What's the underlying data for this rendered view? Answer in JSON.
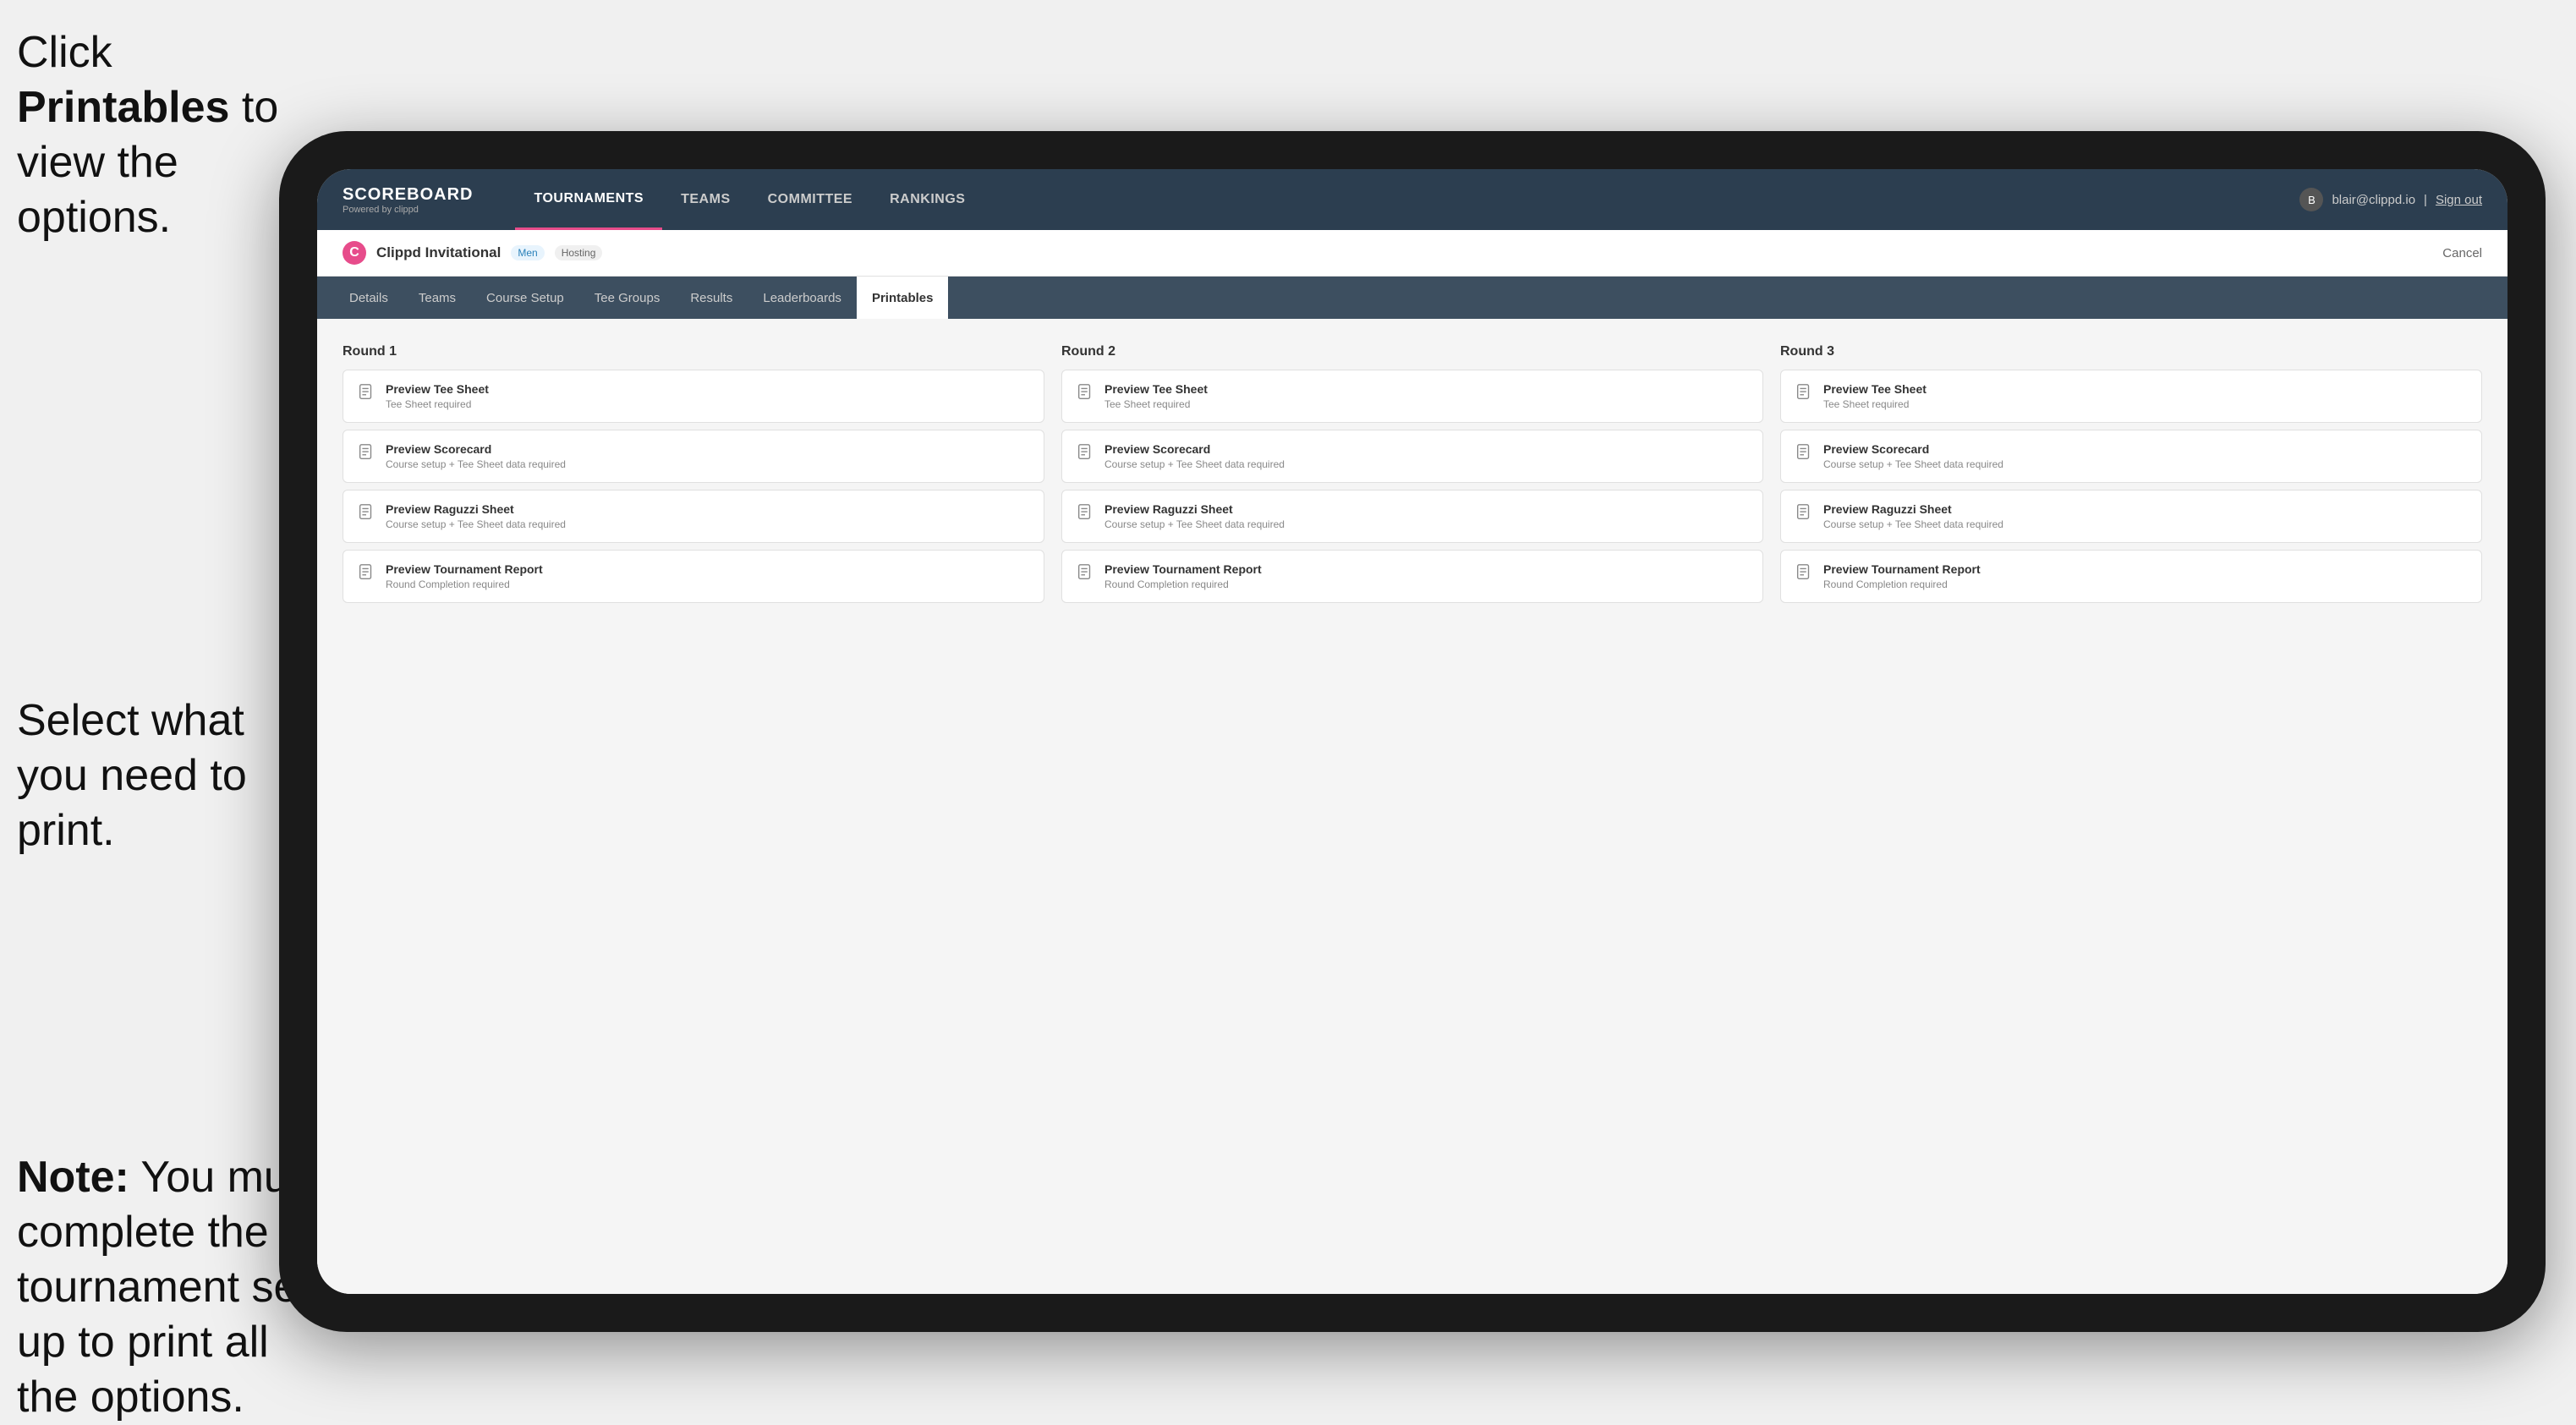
{
  "instructions": {
    "top": {
      "prefix": "Click ",
      "bold": "Printables",
      "suffix": " to view the options."
    },
    "middle": {
      "text": "Select what you need to print."
    },
    "bottom": {
      "bold_prefix": "Note:",
      "text": " You must complete the tournament set-up to print all the options."
    }
  },
  "topNav": {
    "logo": {
      "title": "SCOREBOARD",
      "powered": "Powered by clippd"
    },
    "links": [
      {
        "label": "TOURNAMENTS",
        "active": true
      },
      {
        "label": "TEAMS",
        "active": false
      },
      {
        "label": "COMMITTEE",
        "active": false
      },
      {
        "label": "RANKINGS",
        "active": false
      }
    ],
    "user": {
      "email": "blair@clippd.io",
      "signout": "Sign out"
    }
  },
  "subHeader": {
    "logo": "C",
    "name": "Clippd Invitational",
    "badge": "Men",
    "hosting": "Hosting",
    "cancel": "Cancel"
  },
  "tabs": [
    {
      "label": "Details",
      "active": false
    },
    {
      "label": "Teams",
      "active": false
    },
    {
      "label": "Course Setup",
      "active": false
    },
    {
      "label": "Tee Groups",
      "active": false
    },
    {
      "label": "Results",
      "active": false
    },
    {
      "label": "Leaderboards",
      "active": false
    },
    {
      "label": "Printables",
      "active": true
    }
  ],
  "rounds": [
    {
      "title": "Round 1",
      "cards": [
        {
          "title": "Preview Tee Sheet",
          "subtitle": "Tee Sheet required"
        },
        {
          "title": "Preview Scorecard",
          "subtitle": "Course setup + Tee Sheet data required"
        },
        {
          "title": "Preview Raguzzi Sheet",
          "subtitle": "Course setup + Tee Sheet data required"
        },
        {
          "title": "Preview Tournament Report",
          "subtitle": "Round Completion required"
        }
      ]
    },
    {
      "title": "Round 2",
      "cards": [
        {
          "title": "Preview Tee Sheet",
          "subtitle": "Tee Sheet required"
        },
        {
          "title": "Preview Scorecard",
          "subtitle": "Course setup + Tee Sheet data required"
        },
        {
          "title": "Preview Raguzzi Sheet",
          "subtitle": "Course setup + Tee Sheet data required"
        },
        {
          "title": "Preview Tournament Report",
          "subtitle": "Round Completion required"
        }
      ]
    },
    {
      "title": "Round 3",
      "cards": [
        {
          "title": "Preview Tee Sheet",
          "subtitle": "Tee Sheet required"
        },
        {
          "title": "Preview Scorecard",
          "subtitle": "Course setup + Tee Sheet data required"
        },
        {
          "title": "Preview Raguzzi Sheet",
          "subtitle": "Course setup + Tee Sheet data required"
        },
        {
          "title": "Preview Tournament Report",
          "subtitle": "Round Completion required"
        }
      ]
    }
  ]
}
